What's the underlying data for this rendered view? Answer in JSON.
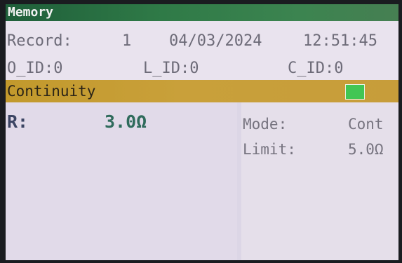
{
  "header": {
    "title": "Memory"
  },
  "record": {
    "label": "Record:",
    "number": "1",
    "date": "04/03/2024",
    "time": "12:51:45"
  },
  "ids": {
    "o_id": "O_ID:0",
    "l_id": "L_ID:0",
    "c_id": "C_ID:0"
  },
  "test": {
    "name": "Continuity",
    "status_color": "#42c654"
  },
  "measurement": {
    "label": "R:",
    "value": "3.0Ω"
  },
  "settings": {
    "mode_label": "Mode:",
    "mode_value": "Cont",
    "limit_label": "Limit:",
    "limit_value": "5.0Ω"
  },
  "colors": {
    "title_bar": "#2f7a47",
    "section_bar": "#c9a03a",
    "screen_bg": "#e2dbe8"
  }
}
